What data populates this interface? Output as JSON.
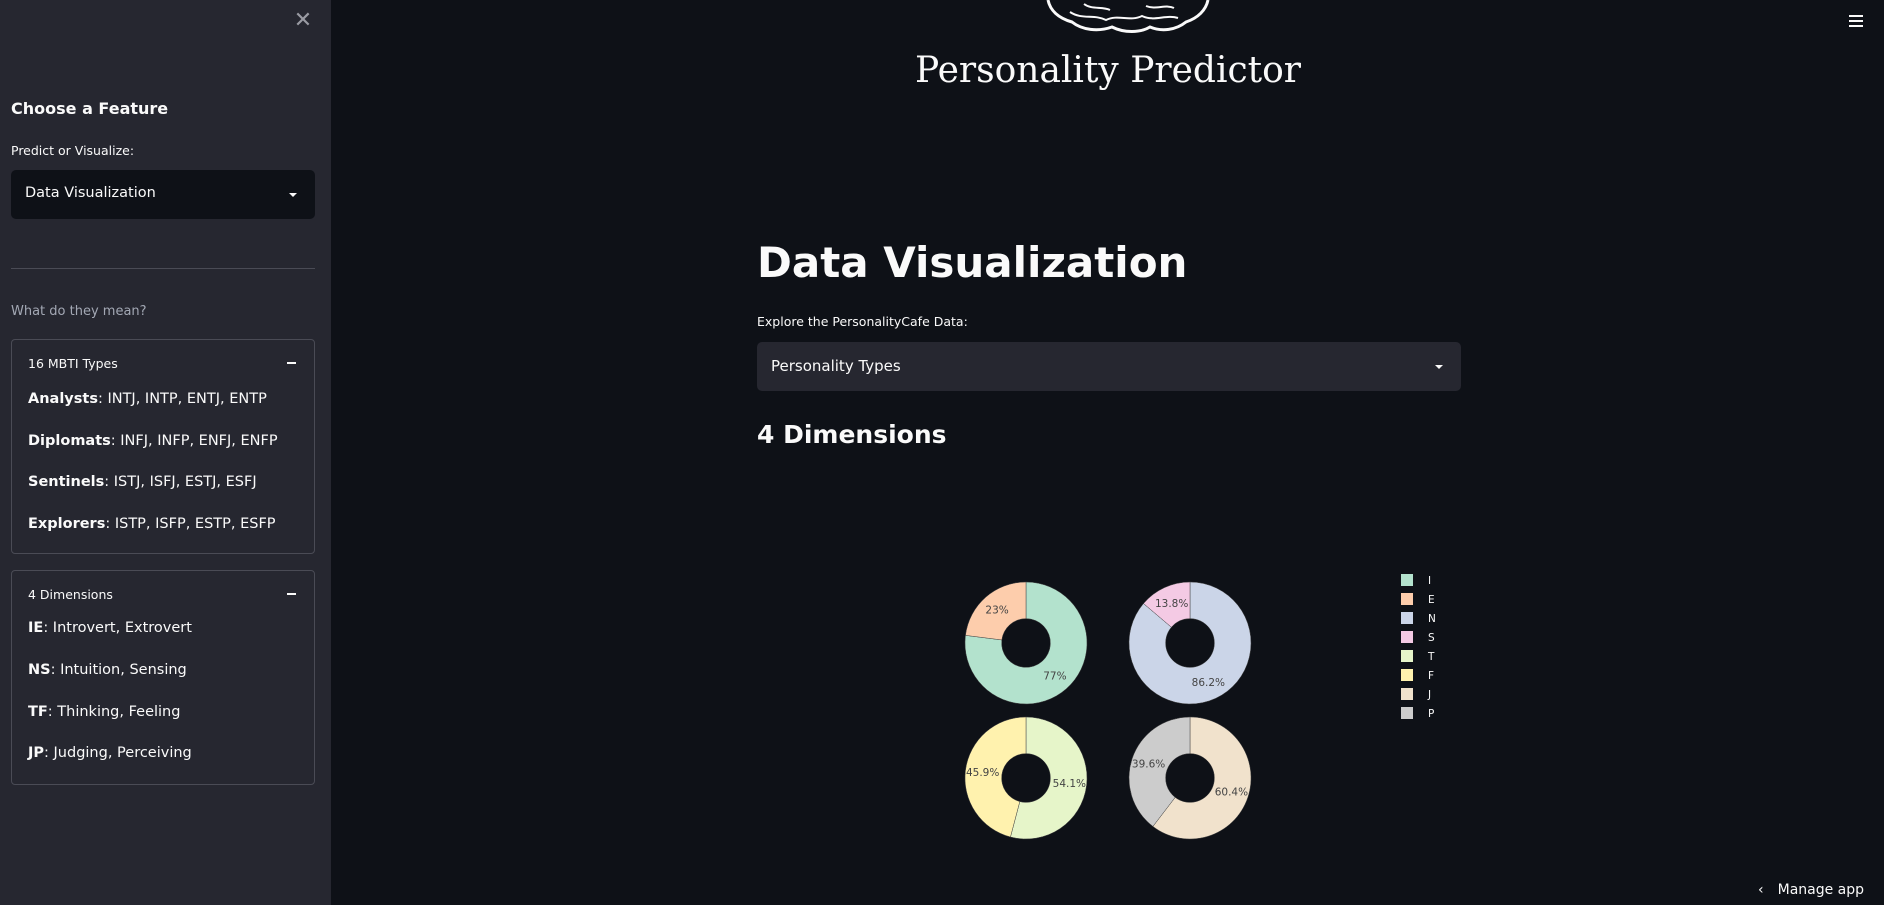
{
  "sidebar": {
    "close_glyph": "✕",
    "heading": "Choose a Feature",
    "select_label": "Predict or Visualize:",
    "select_value": "Data Visualization",
    "muted": "What do they mean?",
    "expanders": [
      {
        "title": "16 MBTI Types",
        "lines": [
          {
            "term": "Analysts",
            "desc": ": INTJ, INTP, ENTJ, ENTP"
          },
          {
            "term": "Diplomats",
            "desc": ": INFJ, INFP, ENFJ, ENFP"
          },
          {
            "term": "Sentinels",
            "desc": ": ISTJ, ISFJ, ESTJ, ESFJ"
          },
          {
            "term": "Explorers",
            "desc": ": ISTP, ISFP, ESTP, ESFP"
          }
        ]
      },
      {
        "title": "4 Dimensions",
        "lines": [
          {
            "term": "IE",
            "desc": ": Introvert, Extrovert"
          },
          {
            "term": "NS",
            "desc": ": Intuition, Sensing"
          },
          {
            "term": "TF",
            "desc": ": Thinking, Feeling"
          },
          {
            "term": "JP",
            "desc": ": Judging, Perceiving"
          }
        ]
      }
    ]
  },
  "main": {
    "app_title": "Personality Predictor",
    "page_title": "Data Visualization",
    "explore_label": "Explore the PersonalityCafe Data:",
    "select_value": "Personality Types",
    "section_title": "4 Dimensions",
    "manage_label": "Manage app",
    "manage_glyph": "‹"
  },
  "chart_data": {
    "type": "pie",
    "hole": 0.4,
    "legend_position": "right",
    "pies": [
      {
        "labels": [
          "I",
          "E"
        ],
        "values": [
          77,
          23
        ],
        "text": [
          "77%",
          "23%"
        ],
        "colors": [
          "#b3e2cd",
          "#fdcdac"
        ]
      },
      {
        "labels": [
          "N",
          "S"
        ],
        "values": [
          86.2,
          13.8
        ],
        "text": [
          "86.2%",
          "13.8%"
        ],
        "colors": [
          "#cbd5e8",
          "#f4cae4"
        ]
      },
      {
        "labels": [
          "T",
          "F"
        ],
        "values": [
          54.1,
          45.9
        ],
        "text": [
          "54.1%",
          "45.9%"
        ],
        "colors": [
          "#e6f5c9",
          "#fff2ae"
        ]
      },
      {
        "labels": [
          "J",
          "P"
        ],
        "values": [
          60.4,
          39.6
        ],
        "text": [
          "60.4%",
          "39.6%"
        ],
        "colors": [
          "#f1e2cc",
          "#cccccc"
        ]
      }
    ],
    "legend": [
      {
        "label": "I",
        "color": "#b3e2cd"
      },
      {
        "label": "E",
        "color": "#fdcdac"
      },
      {
        "label": "N",
        "color": "#cbd5e8"
      },
      {
        "label": "S",
        "color": "#f4cae4"
      },
      {
        "label": "T",
        "color": "#e6f5c9"
      },
      {
        "label": "F",
        "color": "#fff2ae"
      },
      {
        "label": "J",
        "color": "#f1e2cc"
      },
      {
        "label": "P",
        "color": "#cccccc"
      }
    ]
  }
}
